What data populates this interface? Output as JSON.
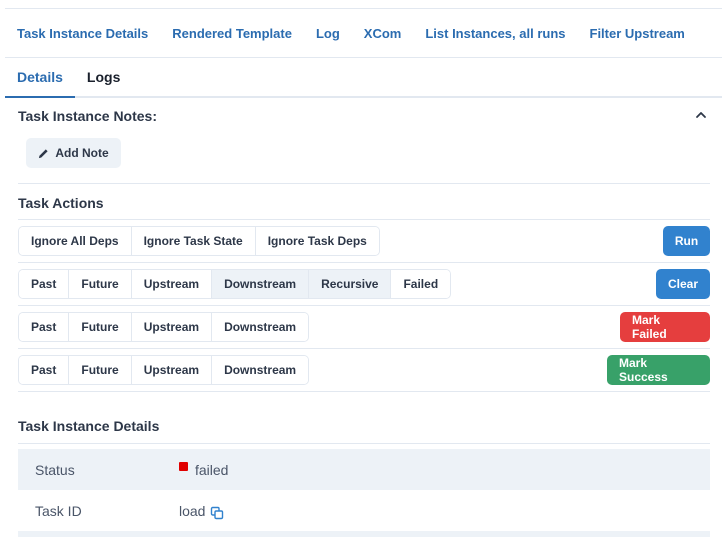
{
  "nav": {
    "links": [
      "Task Instance Details",
      "Rendered Template",
      "Log",
      "XCom",
      "List Instances, all runs",
      "Filter Upstream"
    ]
  },
  "tabs": {
    "details": "Details",
    "logs": "Logs"
  },
  "notes": {
    "title": "Task Instance Notes:",
    "add_note": "Add Note"
  },
  "actions": {
    "title": "Task Actions",
    "run": {
      "options": [
        "Ignore All Deps",
        "Ignore Task State",
        "Ignore Task Deps"
      ],
      "button": "Run"
    },
    "clear": {
      "options": [
        "Past",
        "Future",
        "Upstream",
        "Downstream",
        "Recursive",
        "Failed"
      ],
      "selected": [
        "Downstream",
        "Recursive"
      ],
      "button": "Clear"
    },
    "mark_failed": {
      "options": [
        "Past",
        "Future",
        "Upstream",
        "Downstream"
      ],
      "button": "Mark Failed"
    },
    "mark_success": {
      "options": [
        "Past",
        "Future",
        "Upstream",
        "Downstream"
      ],
      "button": "Mark Success"
    }
  },
  "details": {
    "title": "Task Instance Details",
    "rows": [
      {
        "key": "Status",
        "value": "failed"
      },
      {
        "key": "Task ID",
        "value": "load"
      }
    ]
  },
  "colors": {
    "link": "#2b6cb0",
    "run": "#3182ce",
    "clear": "#3182ce",
    "mark_failed": "#e53e3e",
    "mark_success": "#38a169",
    "status_failed": "#e00000"
  },
  "icons": [
    "pencil-icon",
    "chevron-up-icon",
    "copy-icon",
    "status-square-icon"
  ]
}
